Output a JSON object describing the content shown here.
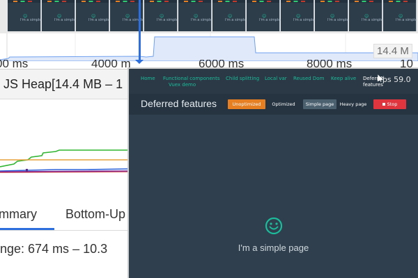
{
  "filmstrip": {
    "frame_count": 12,
    "frame_caption": "I'm a simple page"
  },
  "overview": {
    "memory_label": "14.4 M"
  },
  "ruler": {
    "ticks": [
      "00 ms",
      "4000 m",
      "6000 ms",
      "8000 ms",
      "10"
    ]
  },
  "heap": {
    "title": "JS Heap[14.4 MB – 1"
  },
  "graph_colors": {
    "heap": "#2f63d9",
    "nodes": "#2fb52f",
    "listeners": "#e6a23c",
    "documents": "#d44444",
    "gpu": "#7f2c9b"
  },
  "tabs": {
    "summary": "mmary",
    "bottom_up": "Bottom-Up"
  },
  "range_text": "nge: 674 ms – 10.3",
  "app": {
    "nav": [
      {
        "label": "Home",
        "active": false
      },
      {
        "label": "Functional components",
        "active": false
      },
      {
        "label": "Child splitting",
        "active": false
      },
      {
        "label": "Local var",
        "active": false
      },
      {
        "label": "Reused Dom",
        "active": false
      },
      {
        "label": "Keep alive",
        "active": false
      },
      {
        "label": "Deferred features",
        "active": true
      },
      {
        "label": "Vuex demo",
        "active": false
      }
    ],
    "fps_text": "fps 59.0",
    "heading": "Deferred features",
    "buttons": {
      "unoptimized": "Unoptimized",
      "optimized": "Optimized",
      "simple_page": "Simple page",
      "heavy_page": "Heavy page",
      "stop": "Stop"
    },
    "smiley_color": "#1bbc9b",
    "body_text": "I'm a simple page"
  }
}
